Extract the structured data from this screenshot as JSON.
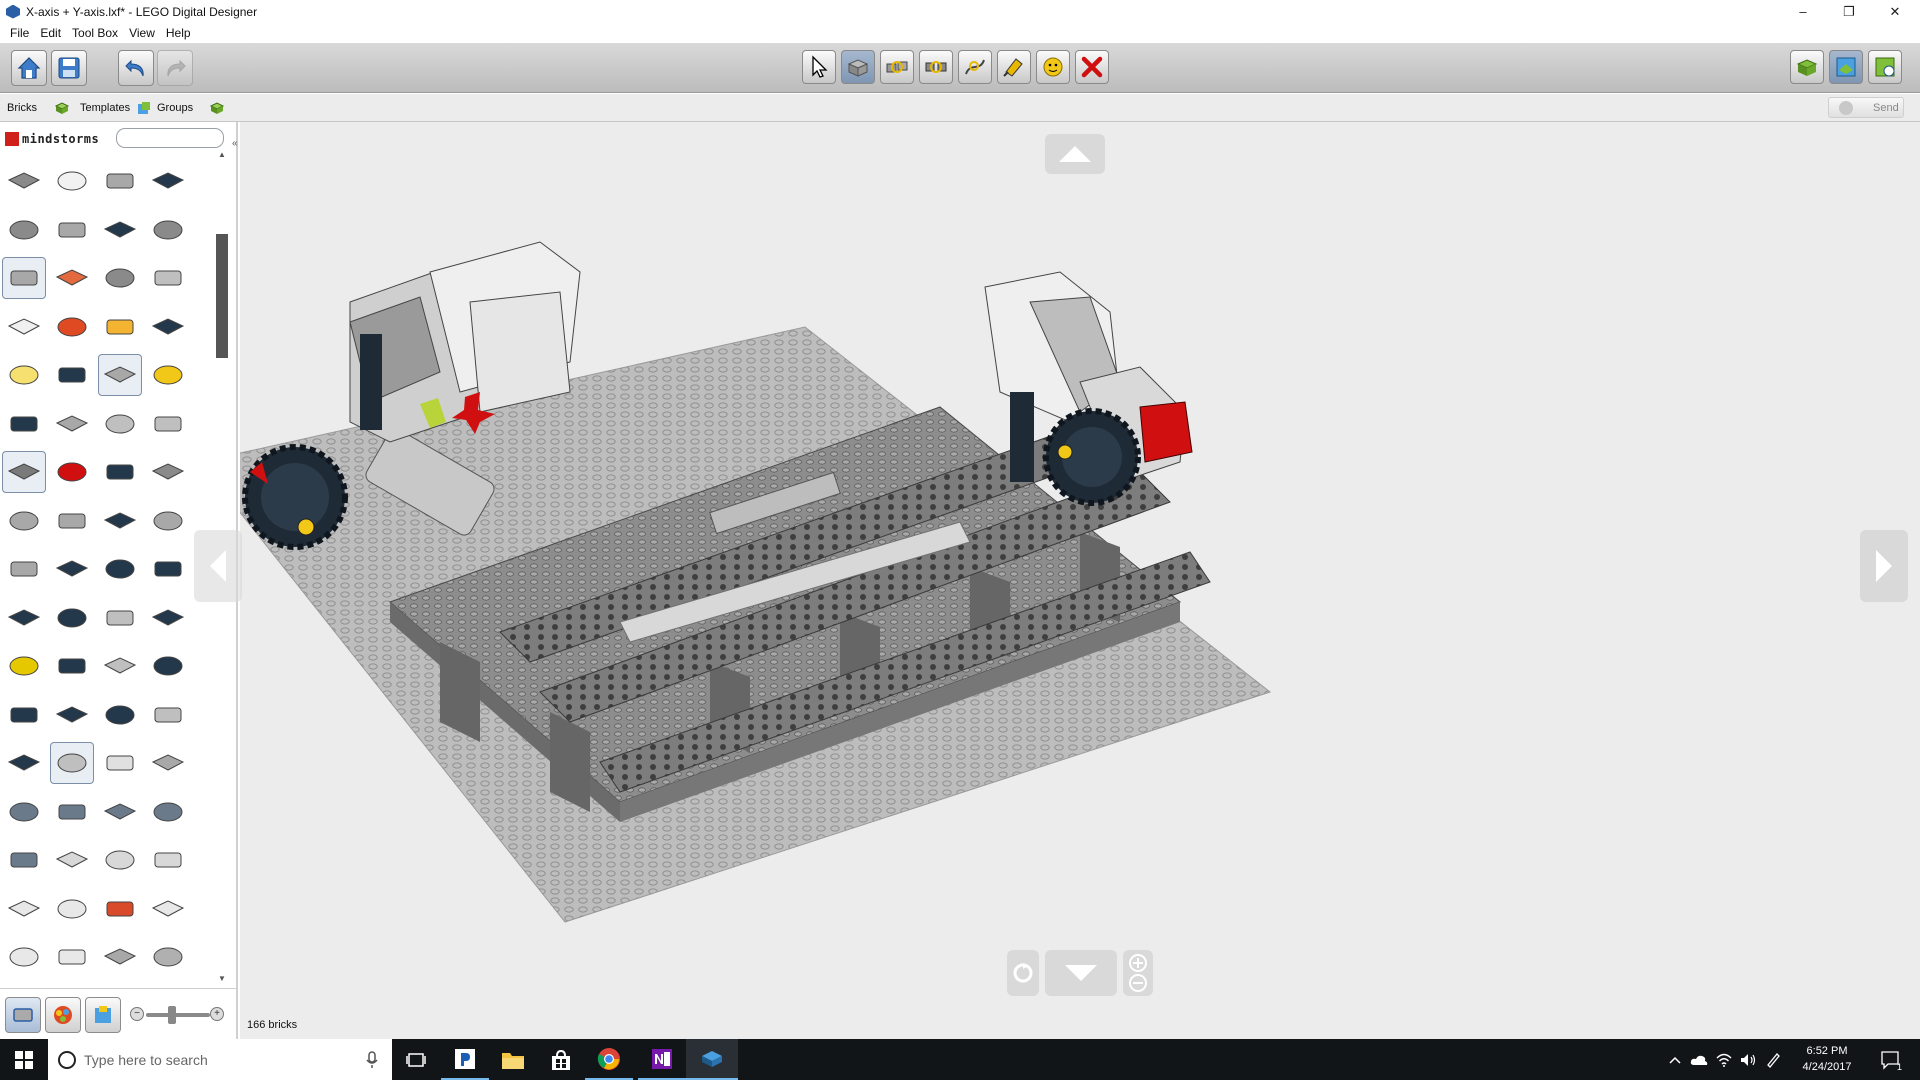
{
  "window": {
    "title": "X-axis + Y-axis.lxf* - LEGO Digital Designer",
    "minimize": "–",
    "restore": "❐",
    "close": "✕"
  },
  "menu": [
    "File",
    "Edit",
    "Tool Box",
    "View",
    "Help"
  ],
  "toolbar": {
    "left": [
      "home-icon",
      "save-icon",
      "undo-icon",
      "redo-icon"
    ],
    "center": [
      "select-tool",
      "clone-tool",
      "hinge-tool",
      "hinge-align-tool",
      "flex-tool",
      "paint-tool",
      "hide-tool",
      "delete-tool"
    ],
    "right": [
      "build-mode",
      "view-mode",
      "building-guide-mode"
    ]
  },
  "tabs": {
    "bricks": "Bricks",
    "templates": "Templates",
    "groups": "Groups",
    "send": "Send"
  },
  "palette": {
    "brand": "mindstorms",
    "search_placeholder": "",
    "bricks": [
      "#8a8a8a",
      "#f2f2f2",
      "#a8a8a8",
      "#23384a",
      "#8a8a8a",
      "#a8a8a8",
      "#23384a",
      "#8a8a8a",
      "#a8a8a8",
      "#e26a3e",
      "#8a8a8a",
      "#bfbfbf",
      "#f0f0f0",
      "#e04a22",
      "#f2b431",
      "#23384a",
      "#f5e070",
      "#23384a",
      "#a8a8a8",
      "#f2c818",
      "#23384a",
      "#a8a8a8",
      "#bfbfbf",
      "#bfbfbf",
      "#7a7a7a",
      "#d01010",
      "#23384a",
      "#8a8a8a",
      "#a8a8a8",
      "#a8a8a8",
      "#23384a",
      "#a8a8a8",
      "#a8a8a8",
      "#23384a",
      "#23384a",
      "#23384a",
      "#23384a",
      "#23384a",
      "#bfbfbf",
      "#23384a",
      "#e6c800",
      "#23384a",
      "#bfbfbf",
      "#23384a",
      "#23384a",
      "#23384a",
      "#23384a",
      "#bfbfbf",
      "#23384a",
      "#bfbfbf",
      "#e0e0e0",
      "#a8a8a8",
      "#6a7a8a",
      "#6a7a8a",
      "#6a7a8a",
      "#6a7a8a",
      "#6a7a8a",
      "#d8d8d8",
      "#d8d8d8",
      "#d8d8d8",
      "#e8e8e8",
      "#e8e8e8",
      "#d84a2a",
      "#e8e8e8",
      "#e8e8e8",
      "#e8e8e8",
      "#a8a8a8",
      "#b0b0b0"
    ]
  },
  "canvas": {
    "background": "#ececec",
    "status": "166 bricks"
  },
  "taskbar": {
    "search_placeholder": "Type here to search",
    "time": "6:52 PM",
    "date": "4/24/2017",
    "notification_count": "1"
  }
}
